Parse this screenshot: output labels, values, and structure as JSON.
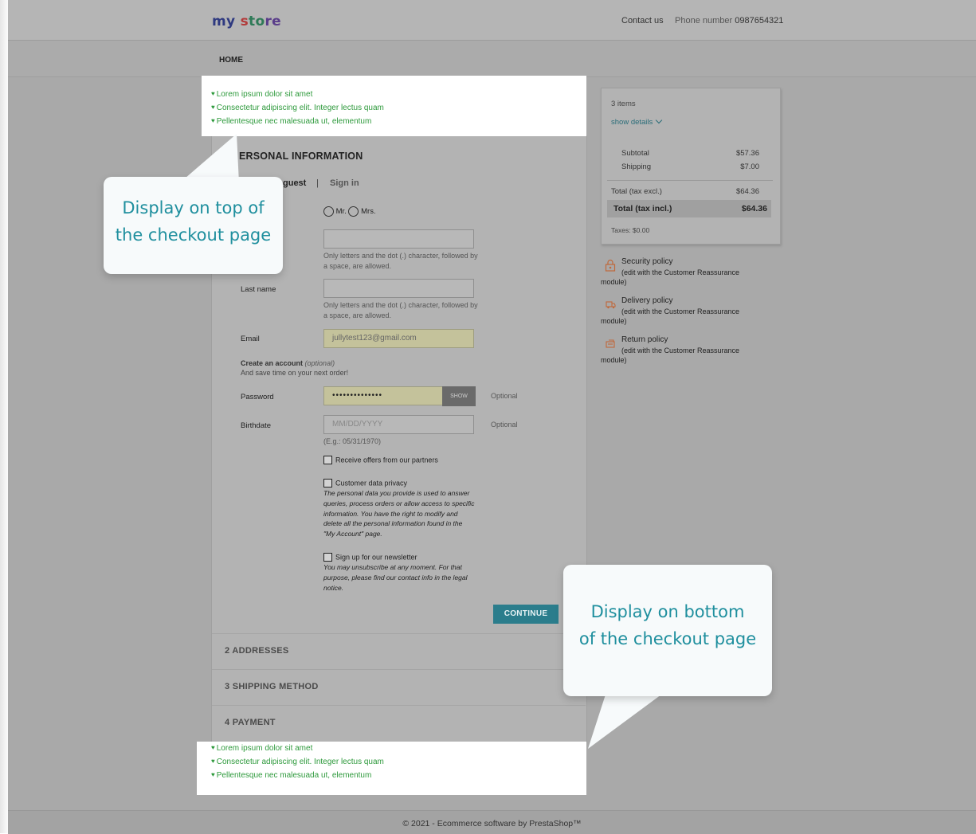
{
  "header": {
    "logo": {
      "part1": "my",
      "part2": "s",
      "part3": "to",
      "part4": "re"
    },
    "contact_link": "Contact us",
    "phone_label": "Phone number",
    "phone_value": "0987654321"
  },
  "nav": {
    "home": "HOME"
  },
  "custom_text_top": [
    "Lorem ipsum dolor sit amet",
    "Consectetur adipiscing elit. Integer lectus quam",
    "Pellentesque nec malesuada ut, elementum"
  ],
  "custom_text_bottom": [
    "Lorem ipsum dolor sit amet",
    "Consectetur adipiscing elit. Integer lectus quam",
    "Pellentesque nec malesuada ut, elementum"
  ],
  "callouts": {
    "top": [
      "Display on top of",
      "the checkout page"
    ],
    "bottom": [
      "Display on bottom",
      "of the checkout page"
    ]
  },
  "checkout": {
    "step1_title": "ERSONAL INFORMATION",
    "tab_guest": "guest",
    "tab_separator": "|",
    "tab_signin": "Sign in",
    "social_title": {
      "mr": "Mr.",
      "mrs": "Mrs."
    },
    "name_hint": "Only letters and the dot (.) character, followed by a space, are allowed.",
    "last_name_label": "Last name",
    "last_name_hint": "Only letters and the dot (.) character, followed by a space, are allowed.",
    "email_label": "Email",
    "email_value": "jullytest123@gmail.com",
    "create_account": "Create an account",
    "create_account_optional": "(optional)",
    "save_time": "And save time on your next order!",
    "password_label": "Password",
    "password_value": "••••••••••••••",
    "show_button": "SHOW",
    "optional": "Optional",
    "birthdate_label": "Birthdate",
    "birthdate_placeholder": "MM/DD/YYYY",
    "birthdate_hint": "(E.g.: 05/31/1970)",
    "offers_label": "Receive offers from our partners",
    "privacy_label": "Customer data privacy",
    "privacy_text": "The personal data you provide is used to answer queries, process orders or allow access to specific information. You have the right to modify and delete all the personal information found in the \"My Account\" page.",
    "newsletter_label": "Sign up for our newsletter",
    "newsletter_text": "You may unsubscribe at any moment. For that purpose, please find our contact info in the legal notice.",
    "continue_button": "CONTINUE",
    "step2": "2   ADDRESSES",
    "step3": "3   SHIPPING METHOD",
    "step4": "4   PAYMENT"
  },
  "cart": {
    "items": "3 items",
    "show_details": "show details",
    "subtotal_label": "Subtotal",
    "subtotal_value": "$57.36",
    "shipping_label": "Shipping",
    "shipping_value": "$7.00",
    "total_excl_label": "Total (tax excl.)",
    "total_excl_value": "$64.36",
    "total_incl_label": "Total (tax incl.)",
    "total_incl_value": "$64.36",
    "taxes": "Taxes: $0.00"
  },
  "reassurance": [
    {
      "title": "Security policy",
      "sub": "(edit with the Customer Reassurance",
      "mod": "module)",
      "icon": "lock-icon"
    },
    {
      "title": "Delivery policy",
      "sub": "(edit with the Customer Reassurance",
      "mod": "module)",
      "icon": "truck-icon"
    },
    {
      "title": "Return policy",
      "sub": "(edit with the Customer Reassurance",
      "mod": "module)",
      "icon": "return-icon"
    }
  ],
  "footer": {
    "text": "© 2021 - Ecommerce software by PrestaShop™"
  },
  "colors": {
    "accent": "#2b7d8c",
    "custom_text_green": "#2e9a3c",
    "callout_text": "#1f8f9e"
  }
}
